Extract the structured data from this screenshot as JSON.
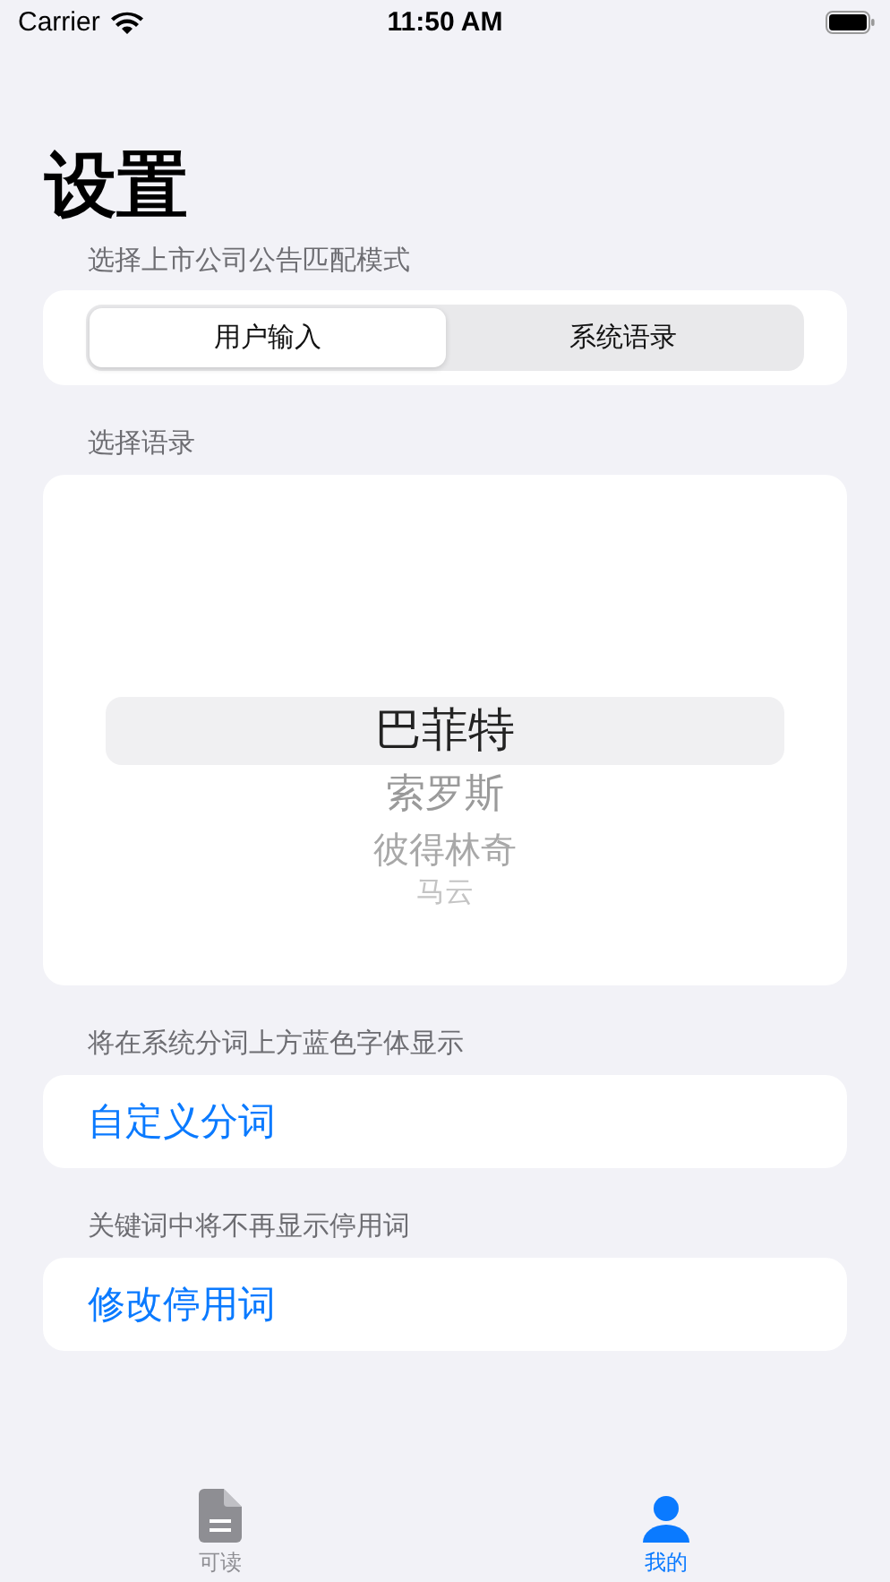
{
  "status_bar": {
    "carrier": "Carrier",
    "time": "11:50 AM"
  },
  "title": "设置",
  "sections": [
    {
      "kind": "segmented",
      "label": "选择上市公司公告匹配模式",
      "segments": [
        {
          "label": "用户输入",
          "selected": true
        },
        {
          "label": "系统语录",
          "selected": false
        }
      ]
    },
    {
      "kind": "picker",
      "label": "选择语录",
      "items": [
        {
          "label": "巴菲特",
          "selected": true
        },
        {
          "label": "索罗斯",
          "selected": false
        },
        {
          "label": "彼得林奇",
          "selected": false
        },
        {
          "label": "马云",
          "selected": false
        }
      ]
    },
    {
      "kind": "link",
      "label": "将在系统分词上方蓝色字体显示",
      "link": "自定义分词"
    },
    {
      "kind": "link",
      "label": "关键词中将不再显示停用词",
      "link": "修改停用词"
    }
  ],
  "tab_bar": [
    {
      "label": "可读",
      "kind": "document",
      "selected": false
    },
    {
      "label": "我的",
      "kind": "person",
      "selected": true
    }
  ]
}
